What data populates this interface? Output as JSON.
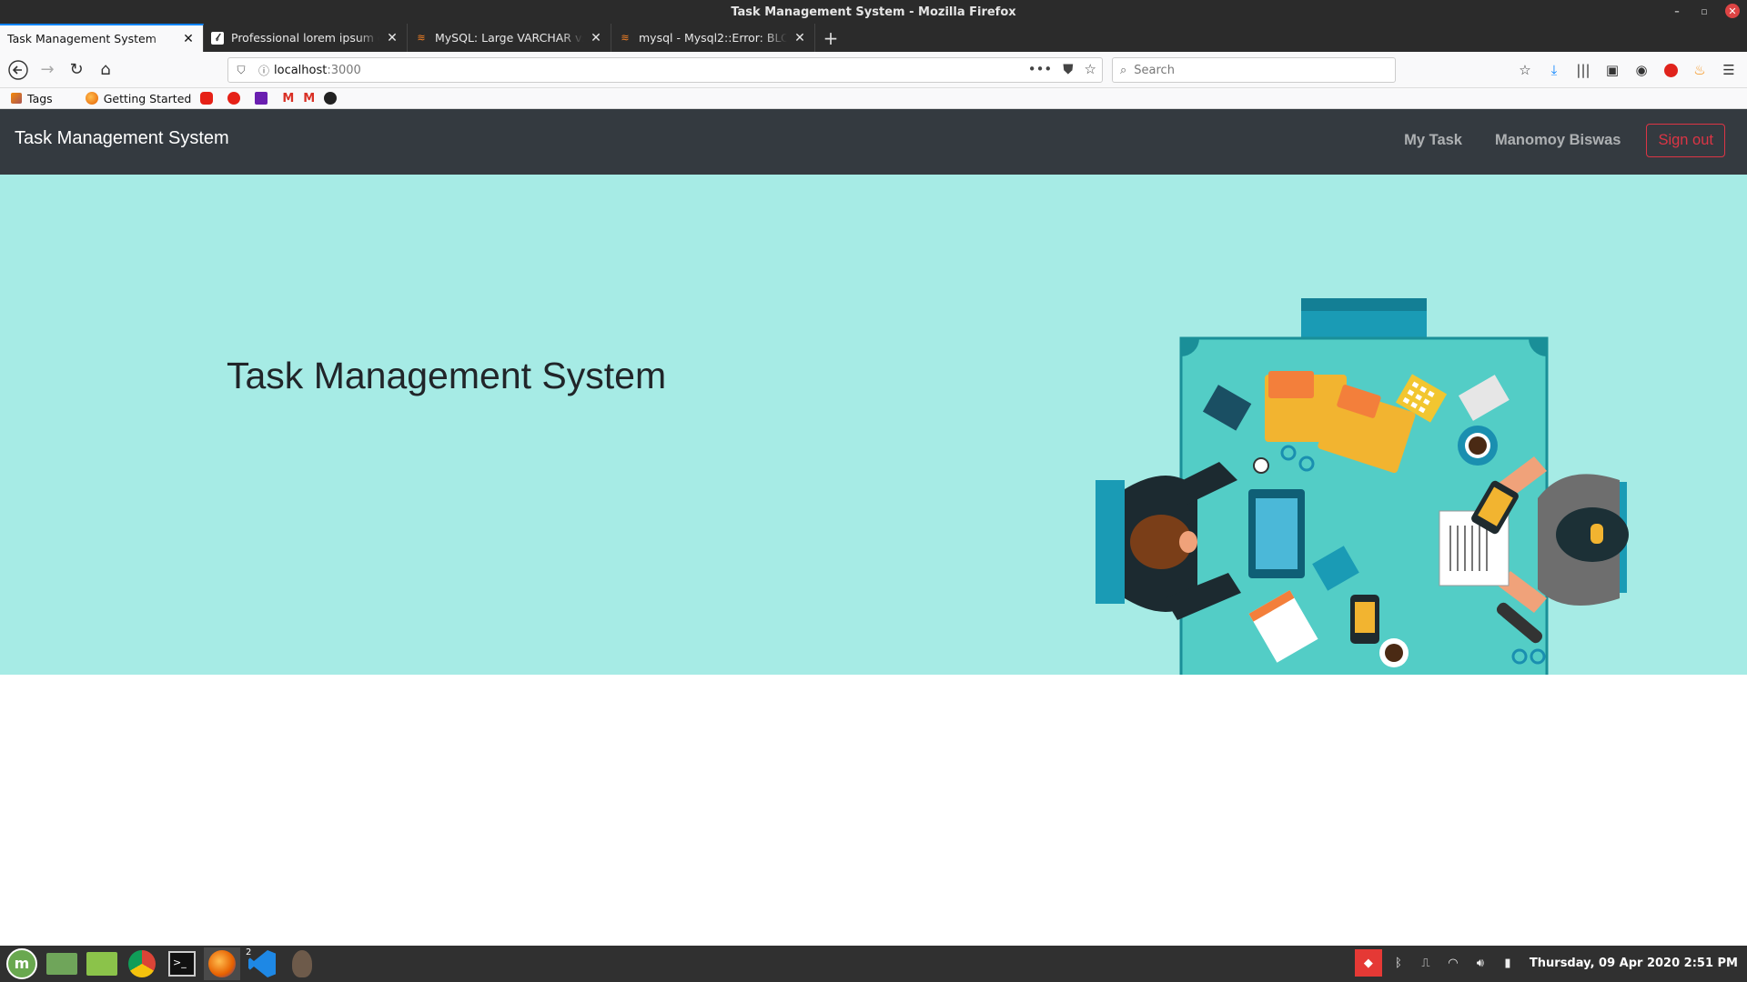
{
  "window": {
    "title": "Task Management System - Mozilla Firefox"
  },
  "tabs": [
    {
      "label": "Task Management System",
      "active": true
    },
    {
      "label": "Professional lorem ipsum g",
      "active": false
    },
    {
      "label": "MySQL: Large VARCHAR vs",
      "active": false
    },
    {
      "label": "mysql - Mysql2::Error: BLOB",
      "active": false
    }
  ],
  "urlbar": {
    "host": "localhost",
    "port": ":3000"
  },
  "searchbar": {
    "placeholder": "Search"
  },
  "bookmarks": [
    {
      "label": "Tags"
    },
    {
      "label": "Getting Started"
    }
  ],
  "app": {
    "brand": "Task Management System",
    "nav": {
      "my_task": "My Task",
      "user_name": "Manomoy Biswas",
      "sign_out": "Sign out"
    },
    "hero": {
      "title": "Task Management System"
    },
    "colors": {
      "navbar_bg": "#343a40",
      "hero_bg": "#a6ebe5",
      "signout": "#dc3545"
    }
  },
  "taskbar": {
    "clock": "Thursday, 09 Apr 2020  2:51 PM",
    "vscode_badge": "2"
  }
}
